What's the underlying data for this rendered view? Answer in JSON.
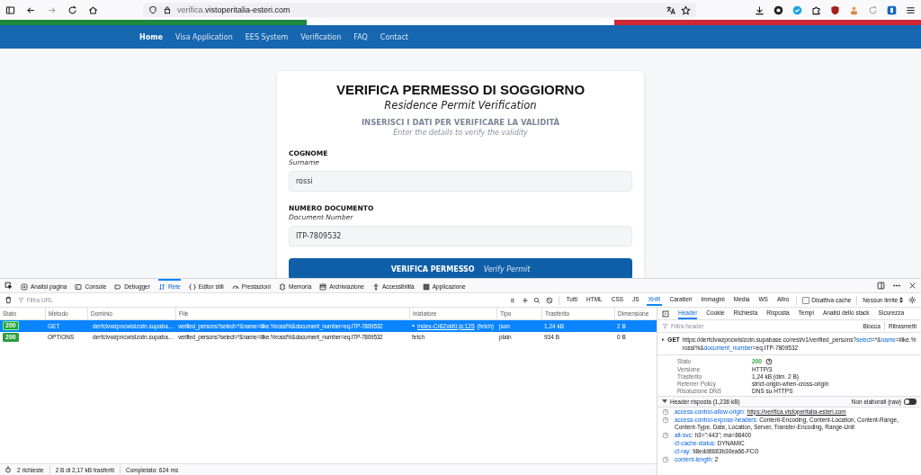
{
  "browser": {
    "url_subdomain": "verifica.",
    "url_domain": "vistoperitalia-esteri.com"
  },
  "nav": [
    {
      "label": "Home",
      "selected": true
    },
    {
      "label": "Visa Application",
      "selected": false
    },
    {
      "label": "EES System",
      "selected": false
    },
    {
      "label": "Verification",
      "selected": false
    },
    {
      "label": "FAQ",
      "selected": false
    },
    {
      "label": "Contact",
      "selected": false
    }
  ],
  "form": {
    "title": "VERIFICA PERMESSO DI SOGGIORNO",
    "subtitle": "Residence Permit Verification",
    "instruction": "INSERISCI I DATI PER VERIFICARE LA VALIDITÀ",
    "instruction_en": "Enter the details to verify the validity",
    "fields": [
      {
        "label": "COGNOME",
        "label_en": "Surname",
        "value": "rossi"
      },
      {
        "label": "NUMERO DOCUMENTO",
        "label_en": "Document Number",
        "value": "ITP-7809532"
      }
    ],
    "button": {
      "label": "VERIFICA PERMESSO",
      "label_en": "Verify Permit"
    }
  },
  "devtools": {
    "tabs": [
      {
        "label": "Analisi pagina",
        "selected": false
      },
      {
        "label": "Console",
        "selected": false
      },
      {
        "label": "Debugger",
        "selected": false
      },
      {
        "label": "Rete",
        "selected": true
      },
      {
        "label": "Editor stili",
        "selected": false
      },
      {
        "label": "Prestazioni",
        "selected": false
      },
      {
        "label": "Memoria",
        "selected": false
      },
      {
        "label": "Archiviazione",
        "selected": false
      },
      {
        "label": "Accessibilità",
        "selected": false
      },
      {
        "label": "Applicazione",
        "selected": false
      }
    ],
    "filter_placeholder": "Filtra URL",
    "type_filters": [
      {
        "label": "Tutti",
        "selected": false
      },
      {
        "label": "HTML",
        "selected": false
      },
      {
        "label": "CSS",
        "selected": false
      },
      {
        "label": "JS",
        "selected": false
      },
      {
        "label": "XHR",
        "selected": true
      },
      {
        "label": "Caratteri",
        "selected": false
      },
      {
        "label": "Immagini",
        "selected": false
      },
      {
        "label": "Media",
        "selected": false
      },
      {
        "label": "WS",
        "selected": false
      },
      {
        "label": "Altro",
        "selected": false
      }
    ],
    "disable_cache": {
      "label": "Disattiva cache",
      "checked": false
    },
    "throttle": "Nessun limite",
    "columns": [
      "Stato",
      "Metodo",
      "Dominio",
      "File",
      "Iniziatore",
      "Tipo",
      "Trasferito",
      "Dimensione"
    ],
    "rows": [
      {
        "status": "200",
        "method": "GET",
        "domain": "derfclvwzpncwislzotn.supaba…",
        "file": "verified_persons?select=*&name=ilike.%rossi%&document_number=eq.ITP-7809532",
        "initiator_link": true,
        "initiator": "index-Cr8ZxkKl.js:125",
        "initiator_note": "(fetch)",
        "type": "json",
        "transferred": "1,24 kB",
        "size": "2 B",
        "selected": true
      },
      {
        "status": "200",
        "method": "OPTIONS",
        "domain": "derfclvwzpncwislzotn.supaba…",
        "file": "verified_persons?select=*&name=ilike.%rossi%&document_number=eq.ITP-7809532",
        "initiator_link": false,
        "initiator": "fetch",
        "type": "plain",
        "transferred": "934 B",
        "size": "0 B",
        "selected": false
      }
    ],
    "status_bar": [
      "2 richieste",
      "2 B di 2,17 kB trasferiti",
      "Completato: 624 ms"
    ],
    "details": {
      "tabs": [
        {
          "label": "Header",
          "selected": true
        },
        {
          "label": "Cookie",
          "selected": false
        },
        {
          "label": "Richiesta",
          "selected": false
        },
        {
          "label": "Risposta",
          "selected": false
        },
        {
          "label": "Tempi",
          "selected": false
        },
        {
          "label": "Analisi dello stack",
          "selected": false
        },
        {
          "label": "Sicurezza",
          "selected": false
        }
      ],
      "filter_placeholder": "Filtra header",
      "actions": [
        "Blocca",
        "Ritrasmetti"
      ],
      "method": "GET",
      "url_parts": [
        {
          "text": "https://derfclvwzpncwislzotn.supabase.co/rest/v1/verified_persons?",
          "kind": "base"
        },
        {
          "text": "select",
          "kind": "param"
        },
        {
          "text": "=*&",
          "kind": "base"
        },
        {
          "text": "name",
          "kind": "param"
        },
        {
          "text": "=ilike.%rossi%&",
          "kind": "base"
        },
        {
          "text": "document_number",
          "kind": "param"
        },
        {
          "text": "=eq.ITP-7809532",
          "kind": "base"
        }
      ],
      "summary": [
        {
          "label": "Stato",
          "value": "200",
          "kind": "status"
        },
        {
          "label": "Versione",
          "value": "HTTP/3",
          "kind": "text"
        },
        {
          "label": "Trasferito",
          "value": "1,24 kB (dim. 2 B)",
          "kind": "text"
        },
        {
          "label": "Referrer Policy",
          "value": "strict-origin-when-cross-origin",
          "kind": "text"
        },
        {
          "label": "Risoluzione DNS",
          "value": "DNS su HTTPS",
          "kind": "text"
        }
      ],
      "response_title": "Header risposta (1,236 kB)",
      "raw_toggle": {
        "label": "Non elaborati (raw)",
        "on": false
      },
      "headers": [
        {
          "name": "access-control-allow-origin:",
          "value": "https://verifica.vistoperitalia-esteri.com",
          "link": true,
          "help": true
        },
        {
          "name": "access-control-expose-headers:",
          "value": "Content-Encoding, Content-Location, Content-Range, Content-Type, Date, Location, Server, Transfer-Encoding, Range-Unit",
          "link": false,
          "help": true
        },
        {
          "name": "alt-svc:",
          "value": "h3=\":443\"; ma=86400",
          "link": false,
          "help": true
        },
        {
          "name": "cf-cache-status:",
          "value": "DYNAMIC",
          "link": false,
          "help": false
        },
        {
          "name": "cf-ray:",
          "value": "98edd8683b30ea66-FCO",
          "link": false,
          "help": false
        },
        {
          "name": "content-length:",
          "value": "2",
          "link": false,
          "help": true
        }
      ]
    }
  }
}
